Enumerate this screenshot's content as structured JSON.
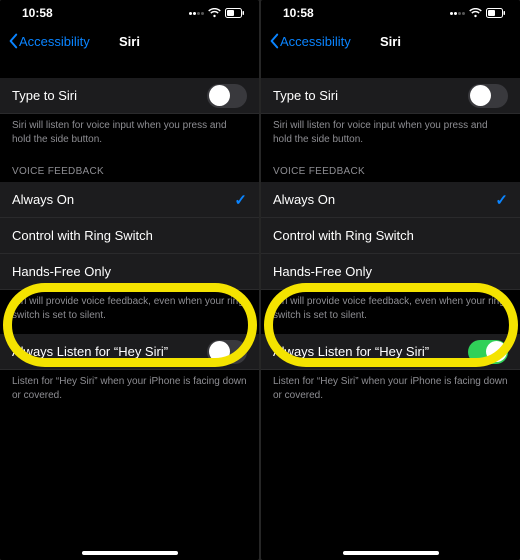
{
  "status": {
    "time": "10:58"
  },
  "nav": {
    "back_label": "Accessibility",
    "title": "Siri"
  },
  "section1": {
    "type_to_siri": "Type to Siri",
    "footer": "Siri will listen for voice input when you press and hold the side button."
  },
  "voice_feedback": {
    "header": "VOICE FEEDBACK",
    "options": [
      "Always On",
      "Control with Ring Switch",
      "Hands-Free Only"
    ],
    "footer": "Siri will provide voice feedback, even when your ring switch is set to silent."
  },
  "hey_siri": {
    "label": "Always Listen for “Hey Siri”",
    "footer": "Listen for “Hey Siri” when your iPhone is facing down or covered."
  },
  "screens": [
    {
      "hey_siri_on": false
    },
    {
      "hey_siri_on": true
    }
  ]
}
